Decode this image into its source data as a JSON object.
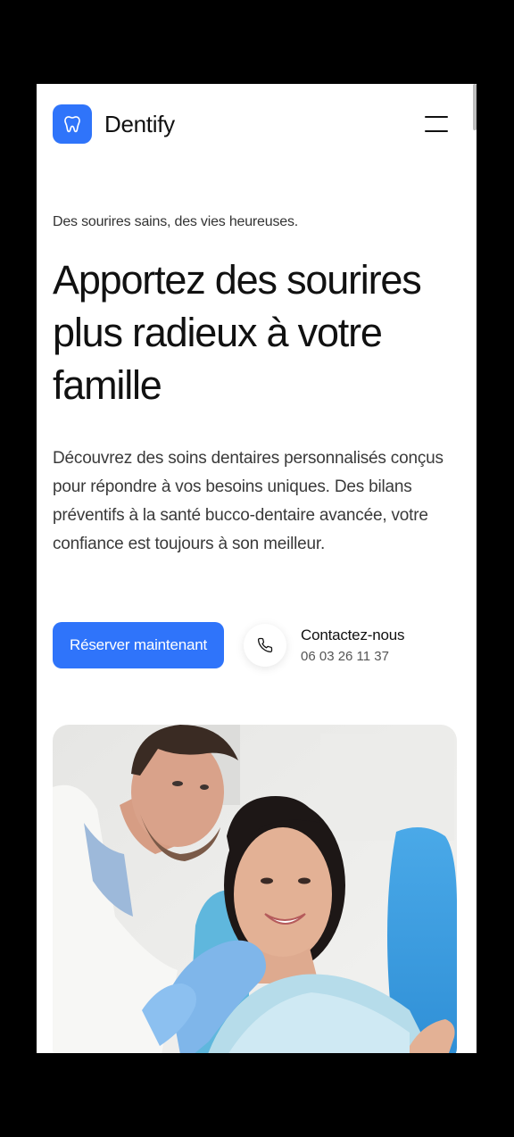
{
  "brand": {
    "name": "Dentify",
    "logo_icon": "tooth-icon",
    "accent_color": "#2f74fa"
  },
  "header": {
    "menu_icon": "hamburger-menu-icon"
  },
  "hero": {
    "tagline": "Des sourires sains, des vies heureuses.",
    "headline": "Apportez des sourires plus radieux à votre famille",
    "description": "Découvrez des soins dentaires personnalisés conçus pour répondre à vos besoins uniques. Des bilans préventifs à la santé bucco-dentaire avancée, votre confiance est toujours à son meilleur.",
    "cta_label": "Réserver maintenant",
    "contact": {
      "icon": "phone-icon",
      "label": "Contactez-nous",
      "phone": "06 03 26 11 37"
    },
    "image": {
      "subject": "dentist-with-smiling-patient-photo"
    }
  }
}
